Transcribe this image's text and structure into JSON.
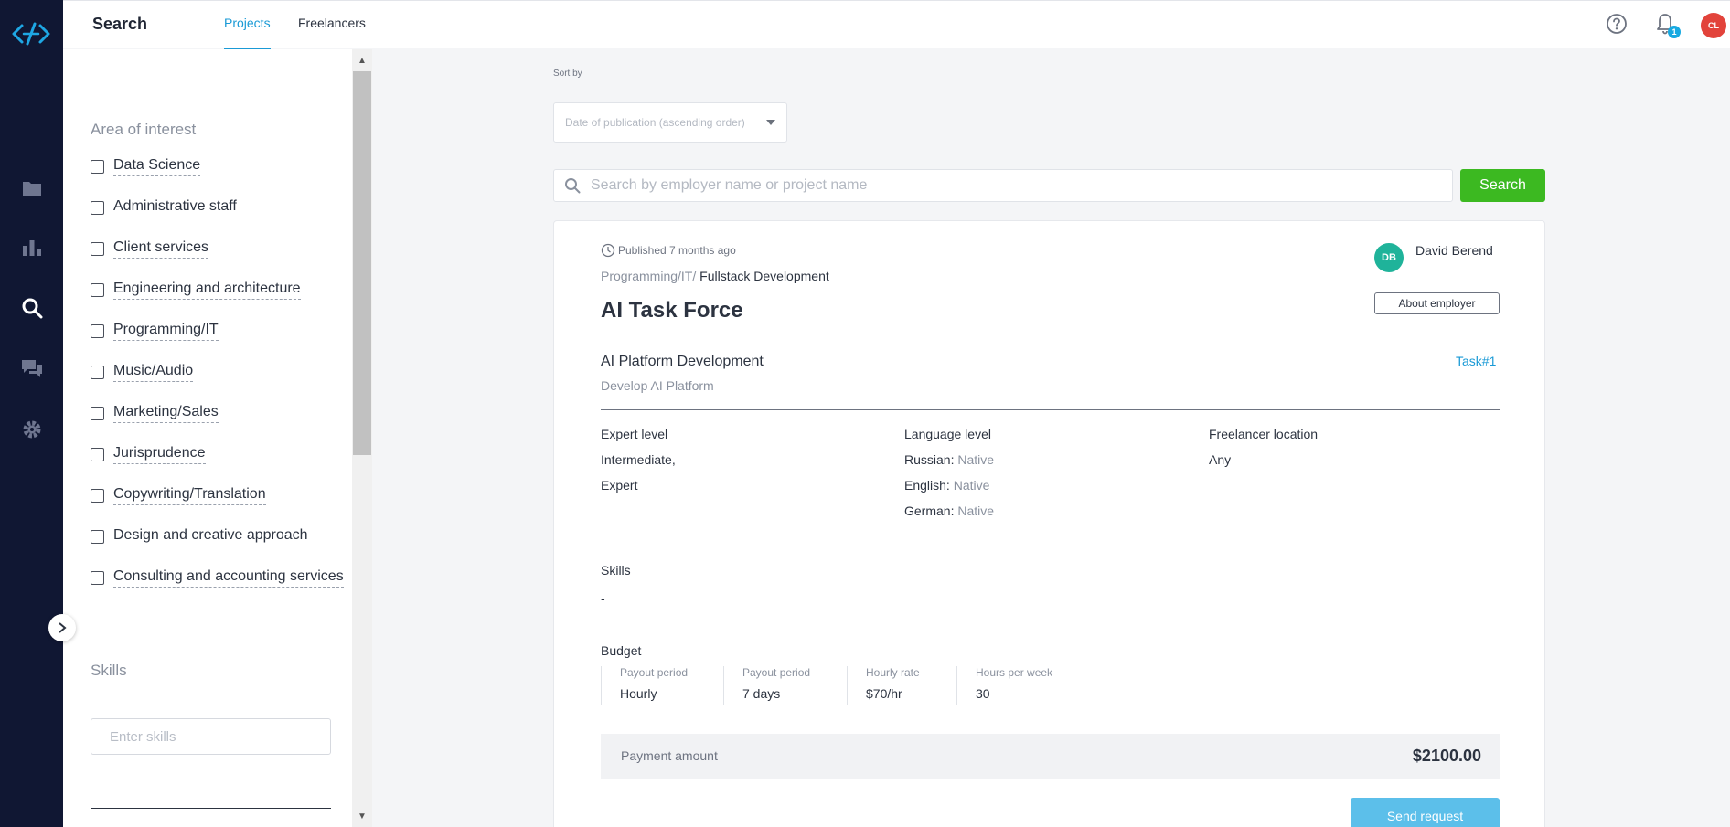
{
  "topbar": {
    "title": "Search",
    "tabs": [
      {
        "label": "Projects",
        "active": true
      },
      {
        "label": "Freelancers",
        "active": false
      }
    ],
    "notification_count": "1",
    "user_initials": "CL"
  },
  "nav": {
    "items": [
      "folder-icon",
      "bar-chart-icon",
      "search-icon",
      "chat-icon",
      "gear-icon"
    ],
    "active": "search-icon"
  },
  "filters": {
    "area_heading": "Area of interest",
    "areas": [
      "Data Science",
      "Administrative staff",
      "Client services",
      "Engineering and architecture",
      "Programming/IT",
      "Music/Audio",
      "Marketing/Sales",
      "Jurisprudence",
      "Copywriting/Translation",
      "Design and creative approach",
      "Consulting and accounting services"
    ],
    "skills_heading": "Skills",
    "skills_placeholder": "Enter skills"
  },
  "sort": {
    "label": "Sort by",
    "value": "Date of publication (ascending order)"
  },
  "search": {
    "placeholder": "Search by employer name or project name",
    "button": "Search"
  },
  "project": {
    "published": "Published 7 months ago",
    "category": "Programming/IT/",
    "subcategory": "Fullstack Development",
    "title": "AI Task Force",
    "employer": {
      "initials": "DB",
      "name": "David Berend",
      "about_button": "About employer"
    },
    "task": {
      "name": "AI Platform Development",
      "description": "Develop AI Platform",
      "link": "Task#1"
    },
    "expert_level": {
      "label": "Expert level",
      "values": [
        "Intermediate,",
        "Expert"
      ]
    },
    "language_level": {
      "label": "Language level",
      "values": [
        {
          "language": "Russian:",
          "level": "Native"
        },
        {
          "language": "English:",
          "level": "Native"
        },
        {
          "language": "German:",
          "level": "Native"
        }
      ]
    },
    "location": {
      "label": "Freelancer location",
      "value": "Any"
    },
    "skills": {
      "label": "Skills",
      "value": "-"
    },
    "budget": {
      "label": "Budget",
      "items": [
        {
          "label": "Payout period",
          "value": "Hourly"
        },
        {
          "label": "Payout period",
          "value": "7 days"
        },
        {
          "label": "Hourly rate",
          "value": "$70/hr"
        },
        {
          "label": "Hours per week",
          "value": "30"
        }
      ]
    },
    "payment": {
      "label": "Payment amount",
      "amount": "$2100.00"
    },
    "send_button": "Send request"
  },
  "colors": {
    "rail": "#101733",
    "accent": "#1a9ad6",
    "search_button": "#3cb921",
    "send_button": "#5cbfea",
    "employer_avatar": "#1fb39a",
    "user_avatar": "#e2433b"
  }
}
